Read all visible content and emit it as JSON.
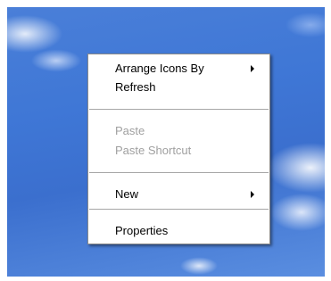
{
  "context_menu": {
    "items": [
      {
        "label": "Arrange Icons By",
        "enabled": true,
        "submenu": true
      },
      {
        "label": "Refresh",
        "enabled": true,
        "submenu": false
      },
      {
        "label": "Paste",
        "enabled": false,
        "submenu": false
      },
      {
        "label": "Paste Shortcut",
        "enabled": false,
        "submenu": false
      },
      {
        "label": "New",
        "enabled": true,
        "submenu": true
      },
      {
        "label": "Properties",
        "enabled": true,
        "submenu": false
      }
    ]
  },
  "colors": {
    "desktop_blue": "#3f77d6",
    "menu_background": "#ffffff",
    "disabled_text": "#a0a0a0",
    "separator": "#a6a6a6"
  }
}
